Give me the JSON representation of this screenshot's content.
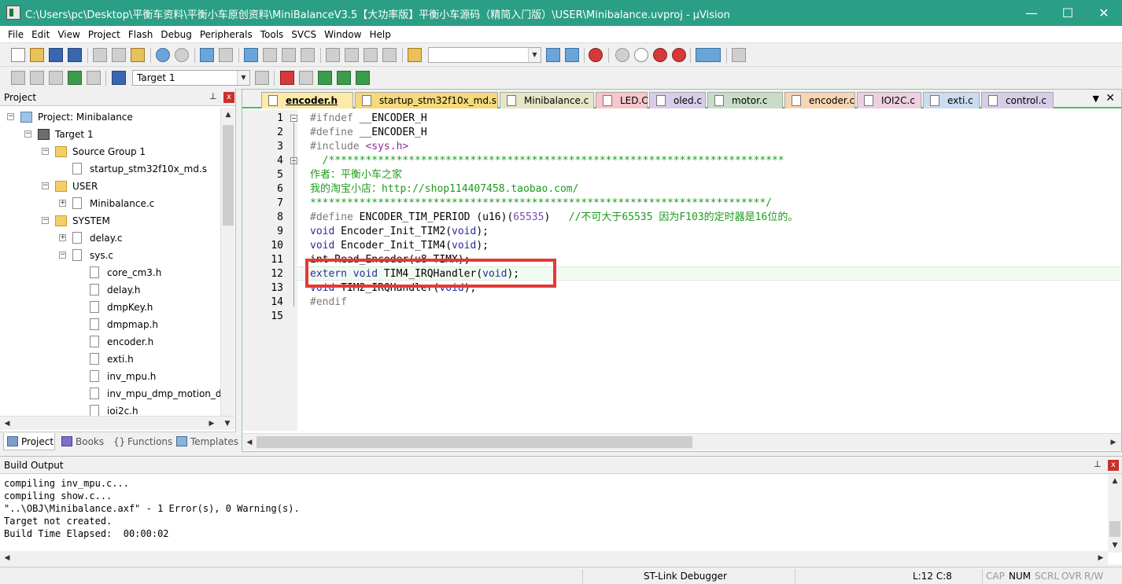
{
  "window": {
    "title": "C:\\Users\\pc\\Desktop\\平衡车资料\\平衡小车原创资料\\MiniBalanceV3.5【大功率版】平衡小车源码（精简入门版）\\USER\\Minibalance.uvproj - µVision",
    "minimize": "—",
    "maximize": "☐",
    "close": "✕"
  },
  "menu": [
    "File",
    "Edit",
    "View",
    "Project",
    "Flash",
    "Debug",
    "Peripherals",
    "Tools",
    "SVCS",
    "Window",
    "Help"
  ],
  "toolbar2": {
    "target": "Target 1"
  },
  "project_panel": {
    "title": "Project",
    "pin": "⊥",
    "close": "x",
    "tree": [
      {
        "label": "Project: Minibalance",
        "level": 0,
        "icon": "project-icon",
        "expander": "−"
      },
      {
        "label": "Target 1",
        "level": 1,
        "icon": "target-icon",
        "expander": "−"
      },
      {
        "label": "Source Group 1",
        "level": 2,
        "icon": "folder-icon",
        "expander": "−"
      },
      {
        "label": "startup_stm32f10x_md.s",
        "level": 3,
        "icon": "file-icon",
        "expander": ""
      },
      {
        "label": "USER",
        "level": 2,
        "icon": "folder-icon",
        "expander": "−"
      },
      {
        "label": "Minibalance.c",
        "level": 3,
        "icon": "file-icon",
        "expander": "+"
      },
      {
        "label": "SYSTEM",
        "level": 2,
        "icon": "folder-icon",
        "expander": "−"
      },
      {
        "label": "delay.c",
        "level": 3,
        "icon": "file-icon",
        "expander": "+"
      },
      {
        "label": "sys.c",
        "level": 3,
        "icon": "file-icon",
        "expander": "−"
      },
      {
        "label": "core_cm3.h",
        "level": 4,
        "icon": "file-icon",
        "expander": ""
      },
      {
        "label": "delay.h",
        "level": 4,
        "icon": "file-icon",
        "expander": ""
      },
      {
        "label": "dmpKey.h",
        "level": 4,
        "icon": "file-icon",
        "expander": ""
      },
      {
        "label": "dmpmap.h",
        "level": 4,
        "icon": "file-icon",
        "expander": ""
      },
      {
        "label": "encoder.h",
        "level": 4,
        "icon": "file-icon",
        "expander": ""
      },
      {
        "label": "exti.h",
        "level": 4,
        "icon": "file-icon",
        "expander": ""
      },
      {
        "label": "inv_mpu.h",
        "level": 4,
        "icon": "file-icon",
        "expander": ""
      },
      {
        "label": "inv_mpu_dmp_motion_dr",
        "level": 4,
        "icon": "file-icon",
        "expander": ""
      },
      {
        "label": "ioi2c.h",
        "level": 4,
        "icon": "file-icon",
        "expander": ""
      }
    ],
    "tabs": [
      "Project",
      "Books",
      "Functions",
      "Templates"
    ]
  },
  "editor": {
    "tabs": [
      {
        "label": "encoder.h",
        "color": "#fde9a8",
        "active": true
      },
      {
        "label": "startup_stm32f10x_md.s",
        "color": "#f5d97a",
        "active": false
      },
      {
        "label": "Minibalance.c",
        "color": "#e4e6c6",
        "active": false
      },
      {
        "label": "LED.C",
        "color": "#f5c6cc",
        "active": false
      },
      {
        "label": "oled.c",
        "color": "#d8cde9",
        "active": false
      },
      {
        "label": "motor.c",
        "color": "#c8dcc8",
        "active": false
      },
      {
        "label": "encoder.c",
        "color": "#f7d4b2",
        "active": false
      },
      {
        "label": "IOI2C.c",
        "color": "#edd0e0",
        "active": false
      },
      {
        "label": "exti.c",
        "color": "#c9dcf0",
        "active": false
      },
      {
        "label": "control.c",
        "color": "#d6cde6",
        "active": false
      }
    ],
    "tab_menu": "▼",
    "tab_close": "✕",
    "line_numbers": [
      "1",
      "2",
      "3",
      "4",
      "5",
      "6",
      "7",
      "8",
      "9",
      "10",
      "11",
      "12",
      "13",
      "14",
      "15"
    ],
    "lines": {
      "l1": {
        "pp": "#ifndef",
        "rest": " __ENCODER_H"
      },
      "l2": {
        "pp": "#define",
        "rest": " __ENCODER_H"
      },
      "l3": {
        "pp": "#include",
        "st": " <sys.h>"
      },
      "l4": "  /**************************************************************************",
      "l5": "作者：平衡小车之家",
      "l6": "我的淘宝小店：http://shop114407458.taobao.com/",
      "l7": "**************************************************************************/",
      "l8": {
        "pp": "#define",
        "mid": " ENCODER_TIM_PERIOD (u16)(",
        "num": "65535",
        "close": ")",
        "cm": "   //不可大于65535 因为F103的定时器是16位的。"
      },
      "l9": {
        "kw": "void",
        "mid": " Encoder_Init_TIM2(",
        "kw2": "void",
        "end": ");"
      },
      "l10": {
        "kw": "void",
        "mid": " Encoder_Init_TIM4(",
        "kw2": "void",
        "end": ");"
      },
      "l11": "int Read_Encoder(u8 TIMX);",
      "l12": {
        "kw": "extern void",
        "mid": " TIM4_IRQHandler(",
        "kw2": "void",
        "end": ");"
      },
      "l13": {
        "kw": "void",
        "mid": " TIM2_IRQHandler(",
        "kw2": "void",
        "end": ");"
      },
      "l14": {
        "pp": "#endif"
      }
    }
  },
  "build_output": {
    "title": "Build Output",
    "pin": "⊥",
    "close": "x",
    "lines": [
      "compiling inv_mpu.c...",
      "compiling show.c...",
      "\"..\\OBJ\\Minibalance.axf\" - 1 Error(s), 0 Warning(s).",
      "Target not created.",
      "Build Time Elapsed:  00:00:02"
    ]
  },
  "status": {
    "debugger": "ST-Link Debugger",
    "position": "L:12 C:8",
    "cap": "CAP",
    "num": "NUM",
    "scrl": "SCRL",
    "ovr": "OVR",
    "rw": "R/W"
  },
  "colors": {
    "titlebar": "#2b9f86",
    "highlight_box": "#e53935",
    "comment": "#1e9a1e",
    "keyword": "#2a2aa0"
  }
}
